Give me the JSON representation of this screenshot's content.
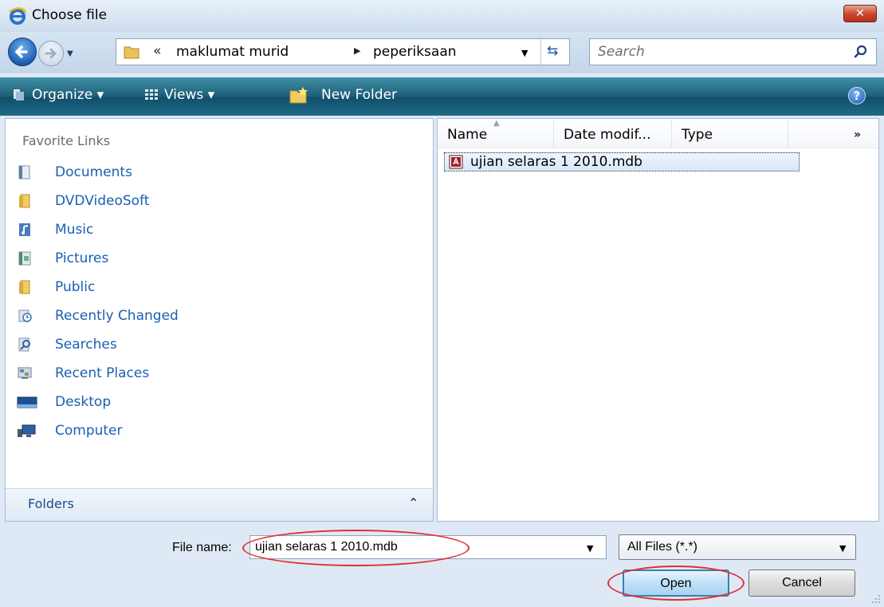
{
  "window": {
    "title": "Choose file",
    "close_label": "✕"
  },
  "address": {
    "chevron": "«",
    "seg1": "maklumat murid",
    "arrow": "▶",
    "seg2": "peperiksaan"
  },
  "search": {
    "placeholder": "Search"
  },
  "toolbar": {
    "organize": "Organize ▾",
    "views": "Views ▾",
    "new_folder": "New Folder",
    "help": "?"
  },
  "favorites": {
    "header": "Favorite Links",
    "items": [
      {
        "label": "Documents",
        "icon": "documents-icon"
      },
      {
        "label": "DVDVideoSoft",
        "icon": "folder-icon"
      },
      {
        "label": "Music",
        "icon": "music-icon"
      },
      {
        "label": "Pictures",
        "icon": "pictures-icon"
      },
      {
        "label": "Public",
        "icon": "folder-icon"
      },
      {
        "label": "Recently Changed",
        "icon": "recently-changed-icon"
      },
      {
        "label": "Searches",
        "icon": "searches-icon"
      },
      {
        "label": "Recent Places",
        "icon": "recent-places-icon"
      },
      {
        "label": "Desktop",
        "icon": "desktop-icon"
      },
      {
        "label": "Computer",
        "icon": "computer-icon"
      }
    ]
  },
  "folders": {
    "label": "Folders",
    "chevron": "⌃"
  },
  "columns": [
    "Name",
    "Date modif...",
    "Type"
  ],
  "more_columns": "»",
  "files": [
    {
      "name": "ujian selaras 1 2010.mdb",
      "icon": "access-db-icon"
    }
  ],
  "bottom": {
    "file_name_label": "File name:",
    "file_name_value": "ujian selaras 1 2010.mdb",
    "file_type": "All Files (*.*)",
    "open": "Open",
    "cancel": "Cancel"
  },
  "colors": {
    "accent": "#1a5fb4",
    "toolbar": "#1e5e78",
    "annotation": "#e03030"
  }
}
